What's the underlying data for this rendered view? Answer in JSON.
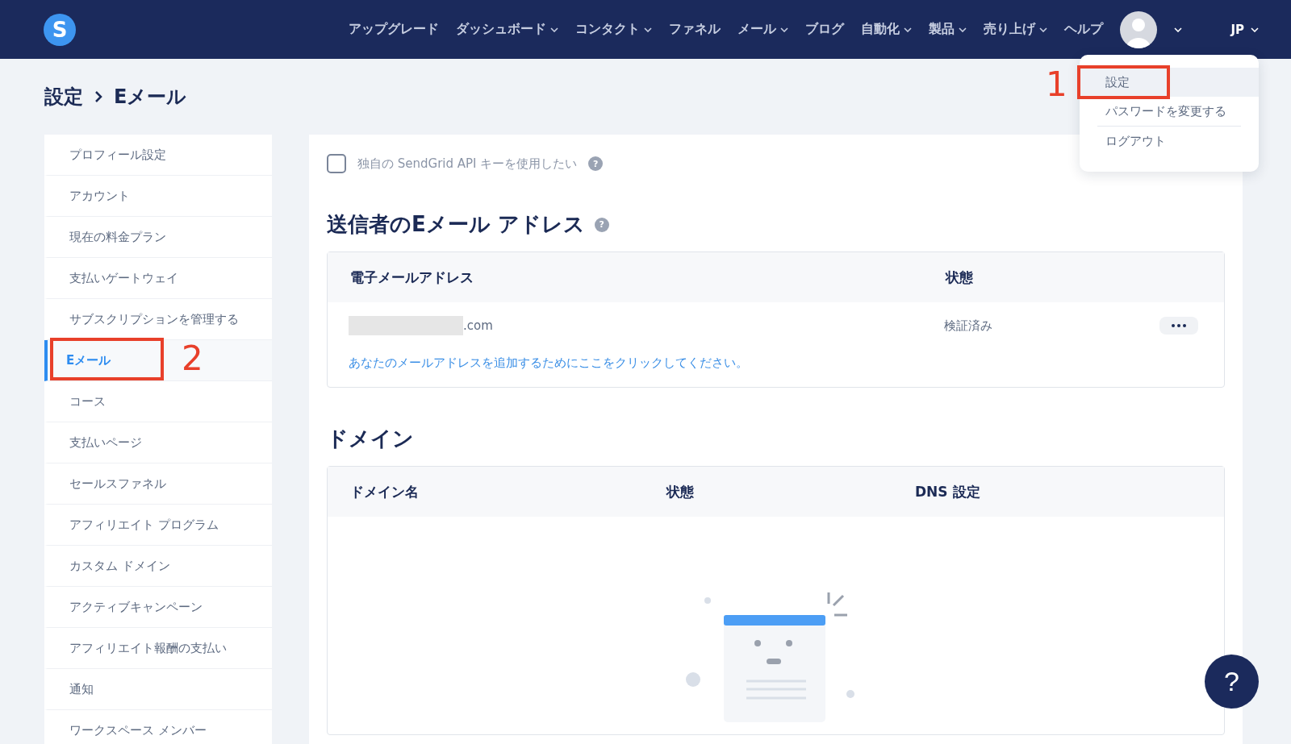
{
  "header": {
    "logo": "S",
    "nav": [
      {
        "label": "アップグレード",
        "caret": false
      },
      {
        "label": "ダッシュボード",
        "caret": true
      },
      {
        "label": "コンタクト",
        "caret": true
      },
      {
        "label": "ファネル",
        "caret": false
      },
      {
        "label": "メール",
        "caret": true
      },
      {
        "label": "ブログ",
        "caret": false
      },
      {
        "label": "自動化",
        "caret": true
      },
      {
        "label": "製品",
        "caret": true
      },
      {
        "label": "売り上げ",
        "caret": true
      },
      {
        "label": "ヘルプ",
        "caret": false
      }
    ],
    "language": "JP"
  },
  "user_menu": {
    "items": [
      {
        "label": "設定",
        "selected": true,
        "divider_after": false
      },
      {
        "label": "パスワードを変更する",
        "selected": false,
        "divider_after": true
      },
      {
        "label": "ログアウト",
        "selected": false,
        "divider_after": false
      }
    ]
  },
  "annotations": [
    {
      "number": "1"
    },
    {
      "number": "2"
    }
  ],
  "breadcrumb": {
    "parent": "設定",
    "current": "Eメール"
  },
  "sidebar": {
    "items": [
      {
        "label": "プロフィール設定",
        "selected": false
      },
      {
        "label": "アカウント",
        "selected": false
      },
      {
        "label": "現在の料金プラン",
        "selected": false
      },
      {
        "label": "支払いゲートウェイ",
        "selected": false
      },
      {
        "label": "サブスクリプションを管理する",
        "selected": false
      },
      {
        "label": "Eメール",
        "selected": true
      },
      {
        "label": "コース",
        "selected": false
      },
      {
        "label": "支払いページ",
        "selected": false
      },
      {
        "label": "セールスファネル",
        "selected": false
      },
      {
        "label": "アフィリエイト プログラム",
        "selected": false
      },
      {
        "label": "カスタム ドメイン",
        "selected": false
      },
      {
        "label": "アクティブキャンペーン",
        "selected": false
      },
      {
        "label": "アフィリエイト報酬の支払い",
        "selected": false
      },
      {
        "label": "通知",
        "selected": false
      },
      {
        "label": "ワークスペース メンバー",
        "selected": false
      }
    ]
  },
  "sendgrid": {
    "label": "独自の SendGrid API キーを使用したい",
    "checked": false
  },
  "sender_section": {
    "title": "送信者のEメール アドレス",
    "columns": [
      "電子メールアドレス",
      "状態"
    ],
    "rows": [
      {
        "email": ".com",
        "status": "検証済み"
      }
    ],
    "add_link": "あなたのメールアドレスを追加するためにここをクリックしてください。"
  },
  "domain_section": {
    "title": "ドメイン",
    "columns": [
      "ドメイン名",
      "状態",
      "DNS 設定"
    ]
  },
  "help_button": "?"
}
